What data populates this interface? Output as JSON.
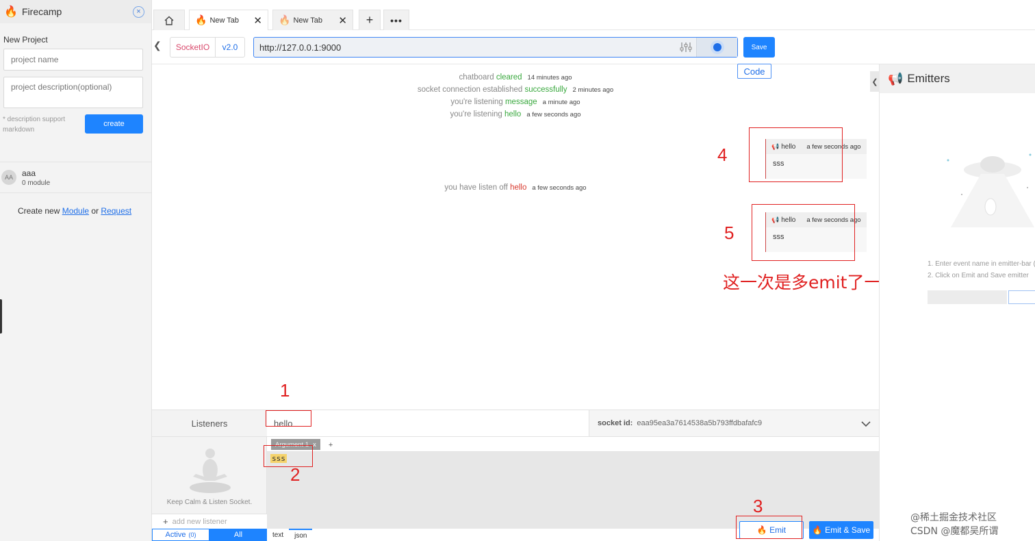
{
  "sidebar": {
    "app_name": "Firecamp",
    "close_icon": "×",
    "new_project_label": "New Project",
    "project_name_placeholder": "project name",
    "project_desc_placeholder": "project description(optional)",
    "desc_note": "* description support markdown",
    "create_label": "create",
    "project": {
      "avatar": "AA",
      "name": "aaa",
      "modules": "0 module"
    },
    "create_new_prefix": "Create new ",
    "module_link": "Module",
    "or_text": " or ",
    "request_link": "Request"
  },
  "tabs": {
    "items": [
      {
        "label": "New Tab",
        "close": "✕"
      },
      {
        "label": "New Tab",
        "close": "✕"
      }
    ],
    "plus": "+",
    "more": "•••"
  },
  "urlbar": {
    "back": "❮",
    "protocol": "SocketIO",
    "version": "v2.0",
    "url": "http://127.0.0.1:9000",
    "save_label": "Save",
    "code_label": "Code"
  },
  "timeline": {
    "logs": [
      {
        "pre": "chatboard ",
        "kw": "cleared",
        "ts": "14 minutes ago"
      },
      {
        "pre": "socket connection established ",
        "kw": "successfully",
        "ts": "2 minutes ago"
      },
      {
        "pre": "you're listening ",
        "kw": "message",
        "ts": "a minute ago"
      },
      {
        "pre": "you're listening ",
        "kw": "hello",
        "ts": "a few seconds ago"
      },
      {
        "pre": "you have listen off ",
        "kw": "hello",
        "ts": "a few seconds ago"
      }
    ],
    "messages": [
      {
        "event": "hello",
        "ts": "a few seconds ago",
        "body": "sss"
      },
      {
        "event": "hello",
        "ts": "a few seconds ago",
        "body": "sss"
      }
    ],
    "annotations": [
      "1",
      "2",
      "3",
      "4",
      "5"
    ],
    "annotation_text": "这一次是多emit了一下"
  },
  "emitters": {
    "collapse": "❮",
    "title": "Emitters",
    "step1": "1. Enter event name in emitter-bar (",
    "step2": "2. Click on Emit and Save emitter"
  },
  "bottom": {
    "listeners_label": "Listeners",
    "event_value": "hello",
    "socket_id_label": "socket id:",
    "socket_id": "eaa95ea3a7614538a5b793ffdbafafc9",
    "chevron": "⌄",
    "calm_caption": "Keep Calm & Listen Socket.",
    "add_listener": "add new listener",
    "tab_active": "Active",
    "tab_active_count": "(0)",
    "tab_all": "All",
    "arg_tab": "Argument 1",
    "arg_tab_close": "x",
    "arg_add": "+",
    "arg_value": "sss",
    "type_text": "text",
    "type_json": "json",
    "emit_label": "Emit",
    "emit_save_label": "Emit & Save"
  },
  "watermark": {
    "line1": "@稀土掘金技术社区",
    "line2": "CSDN @魔都吴所谓"
  },
  "colors": {
    "accent": "#1e84ff",
    "success": "#38a83d",
    "danger": "#d8392e",
    "annotation": "#e02020"
  }
}
